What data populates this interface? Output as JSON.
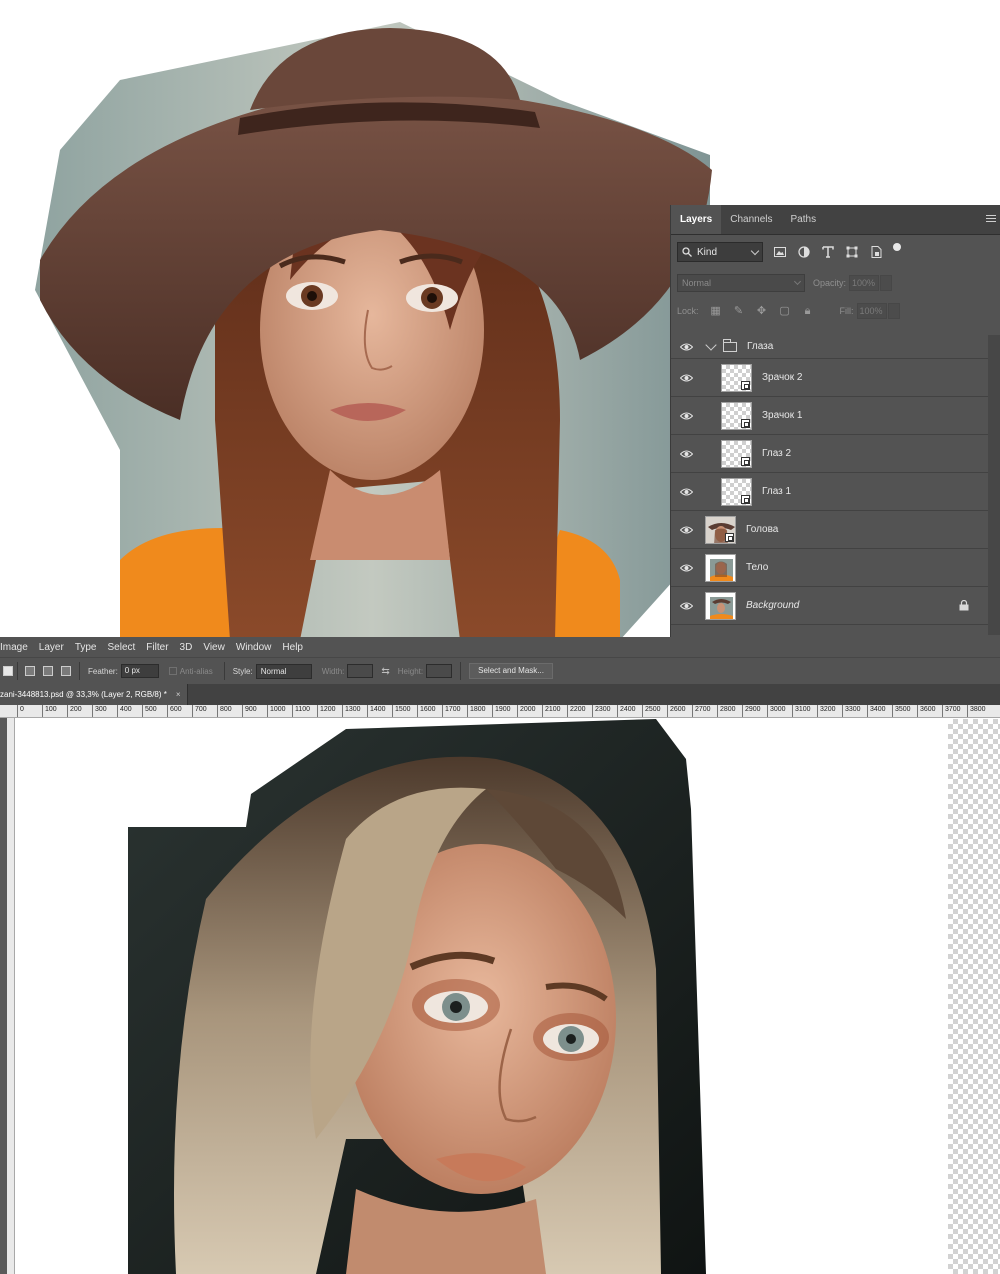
{
  "layers_panel": {
    "tabs": [
      "Layers",
      "Channels",
      "Paths"
    ],
    "filter": {
      "kind_label": "Kind"
    },
    "blend_mode": "Normal",
    "opacity": {
      "label": "Opacity:",
      "value": "100%"
    },
    "lock": {
      "label": "Lock:"
    },
    "fill": {
      "label": "Fill:",
      "value": "100%"
    },
    "layers": [
      {
        "name": "Глаза",
        "type": "group"
      },
      {
        "name": "Зрачок 2",
        "type": "smart-object",
        "thumb": "transparent"
      },
      {
        "name": "Зрачок 1",
        "type": "smart-object",
        "thumb": "transparent"
      },
      {
        "name": "Глаз 2",
        "type": "smart-object",
        "thumb": "transparent"
      },
      {
        "name": "Глаз 1",
        "type": "smart-object",
        "thumb": "transparent"
      },
      {
        "name": "Голова",
        "type": "smart-object",
        "thumb": "photo"
      },
      {
        "name": "Тело",
        "type": "layer",
        "thumb": "photo"
      },
      {
        "name": "Background",
        "type": "background",
        "thumb": "photo",
        "locked": true
      }
    ]
  },
  "menubar": {
    "items": [
      "Image",
      "Layer",
      "Type",
      "Select",
      "Filter",
      "3D",
      "View",
      "Window",
      "Help"
    ]
  },
  "options_bar": {
    "feather_label": "Feather:",
    "feather_value": "0 px",
    "anti_alias_label": "Anti-alias",
    "style_label": "Style:",
    "style_value": "Normal",
    "width_label": "Width:",
    "height_label": "Height:",
    "select_mask_label": "Select and Mask..."
  },
  "document_tab": {
    "title": "zani-3448813.psd @ 33,3% (Layer 2, RGB/8) *",
    "close": "×"
  },
  "ruler": {
    "ticks": [
      "0",
      "100",
      "200",
      "300",
      "400",
      "500",
      "600",
      "700",
      "800",
      "900",
      "1000",
      "1100",
      "1200",
      "1300",
      "1400",
      "1500",
      "1600",
      "1700",
      "1800",
      "1900",
      "2000",
      "2100",
      "2200",
      "2300",
      "2400",
      "2500",
      "2600",
      "2700",
      "2800",
      "2900",
      "3000",
      "3100",
      "3200",
      "3300",
      "3400",
      "3500",
      "3600",
      "3700",
      "3800"
    ]
  },
  "colors": {
    "panel_bg": "#535353",
    "panel_dark": "#424242",
    "sweater": "#f08a1c",
    "hat": "#5a3c32",
    "hair": "#6b3a24"
  },
  "icons": {
    "visibility": "eye-icon",
    "search": "search-icon",
    "lock": "lock-icon",
    "folder": "folder-icon"
  }
}
